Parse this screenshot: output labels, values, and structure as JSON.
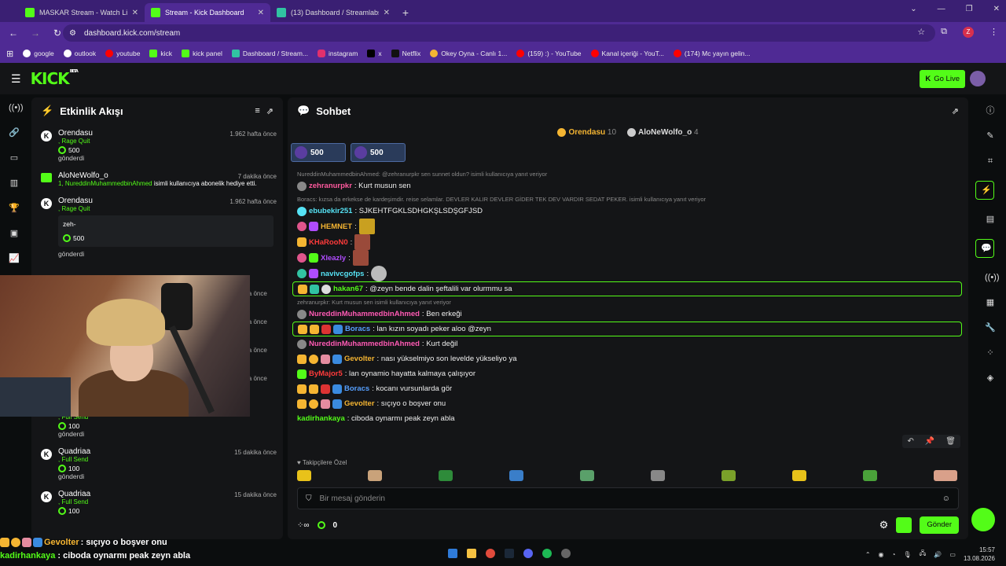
{
  "browser": {
    "tabs": [
      {
        "title": "MASKAR Stream - Watch Live o",
        "active": false
      },
      {
        "title": "Stream - Kick Dashboard",
        "active": true
      },
      {
        "title": "(13) Dashboard / Streamlabs",
        "active": false
      }
    ],
    "new_tab": "+",
    "url": "dashboard.kick.com/stream",
    "profile_initial": "Z",
    "bookmarks": [
      "google",
      "outlook",
      "youtube",
      "kick",
      "kick panel",
      "Dashboard / Stream...",
      "instagram",
      "x",
      "Netflix",
      "Okey Oyna - Canlı 1...",
      "(159) :) - YouTube",
      "Kanal içeriği - YouT...",
      "(174) Mc yayın gelin..."
    ]
  },
  "kick": {
    "logo": "KICK",
    "beta": "BETA",
    "go_live": "Go Live"
  },
  "activity": {
    "title": "Etkinlik Akışı",
    "items": [
      {
        "user": "Orendasu",
        "time": "1.962 hafta önce",
        "detail": ", Rage Quit",
        "amount": "500",
        "sent": "gönderdi"
      },
      {
        "user": "AloNeWolfo_o",
        "time": "7 dakika önce",
        "detail": "1, NureddinMuhammedbinAhmed",
        "detail2": " isimli kullanıcıya abonelik hediye etti."
      },
      {
        "user": "Orendasu",
        "time": "1.962 hafta önce",
        "detail": ", Rage Quit",
        "message": "zeh-",
        "amount": "500",
        "sent": "gönderdi"
      },
      {
        "time": "ika önce"
      },
      {
        "time": "ika önce"
      },
      {
        "time": "ika önce"
      },
      {
        "time": "ika önce"
      },
      {
        "user": "Quadriaa",
        "time": "15 dakika önce",
        "detail": ", Full Send",
        "amount": "100",
        "sent": "gönderdi"
      },
      {
        "user": "Quadriaa",
        "time": "15 dakika önce",
        "detail": ", Full Send",
        "amount": "100",
        "sent": "gönderdi"
      },
      {
        "user": "Quadriaa",
        "time": "15 dakika önce",
        "detail": ", Full Send",
        "amount": "100"
      }
    ]
  },
  "chat": {
    "title": "Sohbet",
    "top_gifters": [
      {
        "name": "Orendasu",
        "count": "10"
      },
      {
        "name": "AloNeWolfo_o",
        "count": "4"
      }
    ],
    "pinned": [
      "500",
      "500"
    ],
    "messages": [
      {
        "reply": "NureddinMuhammedbinAhmed: @zehranurpkr sen sunnet oldun? isimli kullanıcıya yanıt veriyor",
        "user": "zehranurpkr",
        "color": "#ff5a9e",
        "text": ": Kurt musun sen"
      },
      {
        "reply": "Boracs: kızsa da erkekse de kardeşimdir. reise selamlar. DEVLER KALIR DEVLER GİDER TEK DEV VARDIR SEDAT PEKER. isimli kullanıcıya yanıt veriyor",
        "user": "ebubekir251",
        "color": "#56e3f5",
        "text": ": SJKEHTFGKLSDHGKŞLSDŞGFJSD"
      },
      {
        "user": "HEMNET",
        "color": "#f5b532",
        "text": ":"
      },
      {
        "user": "KHaRooN0",
        "color": "#ff3b3b",
        "text": ":"
      },
      {
        "user": "Xleazly",
        "color": "#b04cff",
        "text": ":"
      },
      {
        "user": "navivcgofps",
        "color": "#56e3f5",
        "text": ":"
      },
      {
        "user": "hakan67",
        "color": "#53fc18",
        "text": ": @zeyn bende dalin şeftalili var olurmmu sa",
        "highlight": true
      },
      {
        "reply": "zehranurpkr: Kurt musun sen isimli kullanıcıya yanıt veriyor",
        "user": "NureddinMuhammedbinAhmed",
        "color": "#ff5ab4",
        "text": ": Ben erkeği"
      },
      {
        "user": "Boracs",
        "color": "#56a0ff",
        "text": ": lan kızın soyadı peker aloo @zeyn",
        "highlight": true
      },
      {
        "user": "NureddinMuhammedbinAhmed",
        "color": "#ff5ab4",
        "text": ": Kurt değil"
      },
      {
        "user": "Gevolter",
        "color": "#f5b532",
        "text": ": nası yükselmiyo son levelde yükseliyo ya"
      },
      {
        "user": "ByMajor5",
        "color": "#ff3b3b",
        "text": ": lan oynamio hayatta kalmaya çalışıyor"
      },
      {
        "user": "Boracs",
        "color": "#56a0ff",
        "text": ": kocanı vursunlarda gör"
      },
      {
        "user": "Gevolter",
        "color": "#f5b532",
        "text": ": sıçıyo o boşver onu"
      },
      {
        "user": "kadirhankaya",
        "color": "#53fc18",
        "text": ": ciboda oynarmı peak zeyn abla"
      }
    ],
    "followers_only": "Takipçilere Özel",
    "input_placeholder": "Bir mesaj gönderin",
    "points": "0",
    "send": "Gönder"
  },
  "overlay": {
    "line1_user": "Gevolter",
    "line1_text": " : sıçıyo o boşver onu",
    "line2_user": "kadirhankaya",
    "line2_text": " : ciboda oynarmı peak zeyn abla"
  },
  "taskbar": {
    "time": "15:57",
    "date": "13.08.2026"
  }
}
